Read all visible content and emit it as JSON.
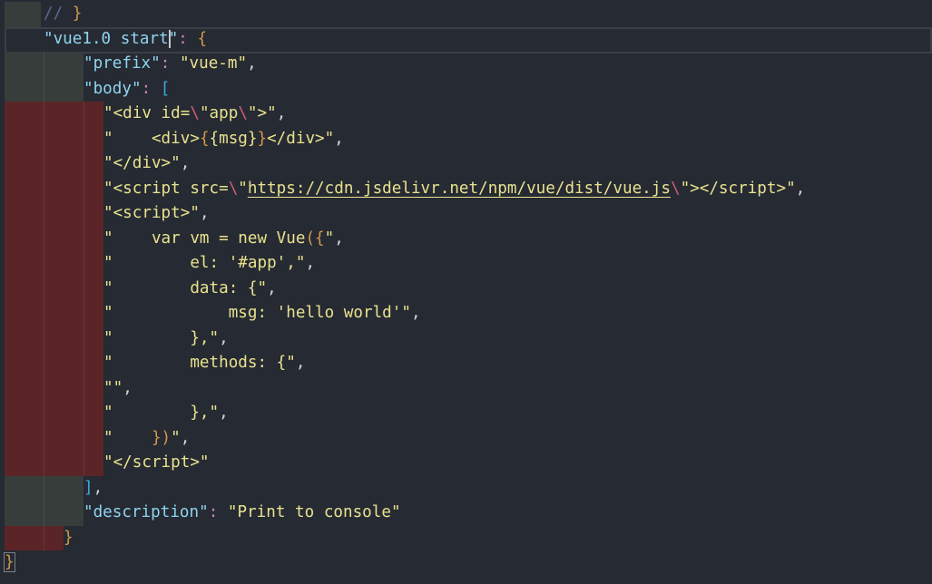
{
  "editor": {
    "lines": [
      {
        "indent": 48,
        "guide": "g",
        "gw": 40,
        "tokens": [
          {
            "t": "// ",
            "c": "com"
          },
          {
            "t": "}",
            "c": "br"
          }
        ]
      },
      {
        "indent": 48,
        "guide": "",
        "gw": 0,
        "current": true,
        "tokens": [
          {
            "t": "\"vue1.0 start",
            "c": "key"
          },
          {
            "caret": true
          },
          {
            "t": "\"",
            "c": "key"
          },
          {
            "t": ": ",
            "c": "col"
          },
          {
            "t": "{",
            "c": "br"
          }
        ]
      },
      {
        "indent": 92,
        "guide": "g",
        "gw": 87,
        "tokens": [
          {
            "t": "\"prefix\"",
            "c": "key"
          },
          {
            "t": ": ",
            "c": "col"
          },
          {
            "t": "\"vue-m\"",
            "c": "str"
          },
          {
            "t": ",",
            "c": "pun"
          }
        ]
      },
      {
        "indent": 92,
        "guide": "g",
        "gw": 87,
        "tokens": [
          {
            "t": "\"body\"",
            "c": "key"
          },
          {
            "t": ": ",
            "c": "col"
          },
          {
            "t": "[",
            "c": "sq"
          }
        ]
      },
      {
        "indent": 114,
        "guide": "r",
        "gw": 109,
        "tokens": [
          {
            "t": "\"<div id=",
            "c": "str"
          },
          {
            "t": "\\",
            "c": "esc"
          },
          {
            "t": "\"app",
            "c": "str"
          },
          {
            "t": "\\",
            "c": "esc"
          },
          {
            "t": "\">\"",
            "c": "str"
          },
          {
            "t": ",",
            "c": "pun"
          }
        ]
      },
      {
        "indent": 114,
        "guide": "r",
        "gw": 109,
        "tokens": [
          {
            "t": "\"    <div>",
            "c": "str"
          },
          {
            "t": "{",
            "c": "br"
          },
          {
            "t": "{msg}",
            "c": "str"
          },
          {
            "t": "}",
            "c": "br"
          },
          {
            "t": "</div>\"",
            "c": "str"
          },
          {
            "t": ",",
            "c": "pun"
          }
        ]
      },
      {
        "indent": 114,
        "guide": "r",
        "gw": 109,
        "tokens": [
          {
            "t": "\"</div>\"",
            "c": "str"
          },
          {
            "t": ",",
            "c": "pun"
          }
        ]
      },
      {
        "indent": 114,
        "guide": "r",
        "gw": 109,
        "tokens": [
          {
            "t": "\"<script src=",
            "c": "str"
          },
          {
            "t": "\\",
            "c": "esc"
          },
          {
            "t": "\"",
            "c": "str"
          },
          {
            "t": "https://cdn.jsdelivr.net/npm/vue/dist/vue.js",
            "c": "url"
          },
          {
            "t": "\\",
            "c": "esc"
          },
          {
            "t": "\"></script>\"",
            "c": "str"
          },
          {
            "t": ",",
            "c": "pun"
          }
        ]
      },
      {
        "indent": 114,
        "guide": "r",
        "gw": 109,
        "tokens": [
          {
            "t": "\"<script>\"",
            "c": "str"
          },
          {
            "t": ",",
            "c": "pun"
          }
        ]
      },
      {
        "indent": 114,
        "guide": "r",
        "gw": 109,
        "tokens": [
          {
            "t": "\"    var vm = new Vue",
            "c": "str"
          },
          {
            "t": "({",
            "c": "br"
          },
          {
            "t": "\"",
            "c": "str"
          },
          {
            "t": ",",
            "c": "pun"
          }
        ]
      },
      {
        "indent": 114,
        "guide": "r",
        "gw": 109,
        "tokens": [
          {
            "t": "\"        el: '#app',\"",
            "c": "str"
          },
          {
            "t": ",",
            "c": "pun"
          }
        ]
      },
      {
        "indent": 114,
        "guide": "r",
        "gw": 109,
        "tokens": [
          {
            "t": "\"        data: {\"",
            "c": "str"
          },
          {
            "t": ",",
            "c": "pun"
          }
        ]
      },
      {
        "indent": 114,
        "guide": "r",
        "gw": 109,
        "tokens": [
          {
            "t": "\"            msg: 'hello world'\"",
            "c": "str"
          },
          {
            "t": ",",
            "c": "pun"
          }
        ]
      },
      {
        "indent": 114,
        "guide": "r",
        "gw": 109,
        "tokens": [
          {
            "t": "\"        },\"",
            "c": "str"
          },
          {
            "t": ",",
            "c": "pun"
          }
        ]
      },
      {
        "indent": 114,
        "guide": "r",
        "gw": 109,
        "tokens": [
          {
            "t": "\"        methods: {\"",
            "c": "str"
          },
          {
            "t": ",",
            "c": "pun"
          }
        ]
      },
      {
        "indent": 114,
        "guide": "r",
        "gw": 109,
        "tokens": [
          {
            "t": "\"\"",
            "c": "str"
          },
          {
            "t": ",",
            "c": "pun"
          }
        ]
      },
      {
        "indent": 114,
        "guide": "r",
        "gw": 109,
        "tokens": [
          {
            "t": "\"        },\"",
            "c": "str"
          },
          {
            "t": ",",
            "c": "pun"
          }
        ]
      },
      {
        "indent": 114,
        "guide": "r",
        "gw": 109,
        "tokens": [
          {
            "t": "\"    ",
            "c": "str"
          },
          {
            "t": "})",
            "c": "br"
          },
          {
            "t": "\"",
            "c": "str"
          },
          {
            "t": ",",
            "c": "pun"
          }
        ]
      },
      {
        "indent": 114,
        "guide": "r",
        "gw": 109,
        "tokens": [
          {
            "t": "\"</script>\"",
            "c": "str"
          }
        ]
      },
      {
        "indent": 92,
        "guide": "g",
        "gw": 87,
        "tokens": [
          {
            "t": "]",
            "c": "sq"
          },
          {
            "t": ",",
            "c": "pun"
          }
        ]
      },
      {
        "indent": 92,
        "guide": "g",
        "gw": 87,
        "tokens": [
          {
            "t": "\"description\"",
            "c": "key"
          },
          {
            "t": ": ",
            "c": "col"
          },
          {
            "t": "\"Print to console\"",
            "c": "str"
          }
        ]
      },
      {
        "indent": 70,
        "guide": "r",
        "gw": 65,
        "tokens": [
          {
            "t": "}",
            "c": "br"
          }
        ]
      },
      {
        "indent": 5,
        "guide": "",
        "gw": 0,
        "tokens": [
          {
            "t": "}",
            "c": "br lastbrace"
          }
        ]
      }
    ]
  }
}
